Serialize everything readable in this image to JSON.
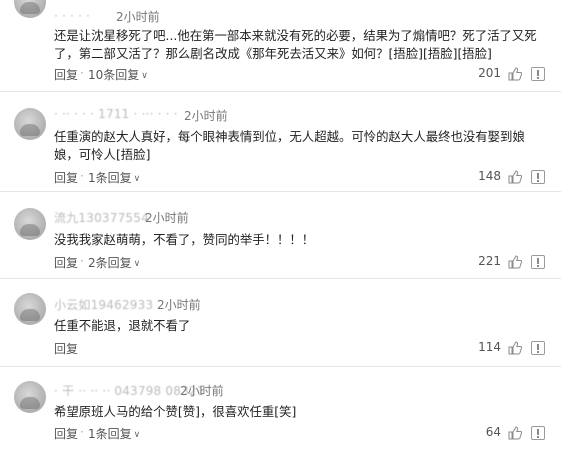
{
  "comments": [
    {
      "username": "· · · · ·",
      "time": "2小时前",
      "text": "还是让沈星移死了吧...他在第一部本来就没有死的必要，结果为了煽情吧？死了活了又死了，第二部又活了？那么剧名改成《那年死去活又来》如何？[捂脸][捂脸][捂脸]",
      "reply_label": "回复",
      "replies_label": "10条回复",
      "likes": "201"
    },
    {
      "username": "· ·· · · · 1711 · ··· · · ·",
      "time": "2小时前",
      "text": "任重演的赵大人真好，每个眼神表情到位，无人超越。可怜的赵大人最终也没有娶到娘娘，可怜人[捂脸]",
      "reply_label": "回复",
      "replies_label": "1条回复",
      "likes": "148"
    },
    {
      "username": "流九130377554",
      "time": "2小时前",
      "text": "没我我家赵萌萌，不看了，赞同的举手！！！！",
      "reply_label": "回复",
      "replies_label": "2条回复",
      "likes": "221"
    },
    {
      "username": "小云如19462933",
      "time": "2小时前",
      "text": "任重不能退，退就不看了",
      "reply_label": "回复",
      "replies_label": "",
      "likes": "114"
    },
    {
      "username": "· 干 ·· ·· ·· 043798 08321",
      "time": "2小时前",
      "text": "希望原班人马的给个赞[赞]，很喜欢任重[笑]",
      "reply_label": "回复",
      "replies_label": "1条回复",
      "likes": "64"
    }
  ]
}
